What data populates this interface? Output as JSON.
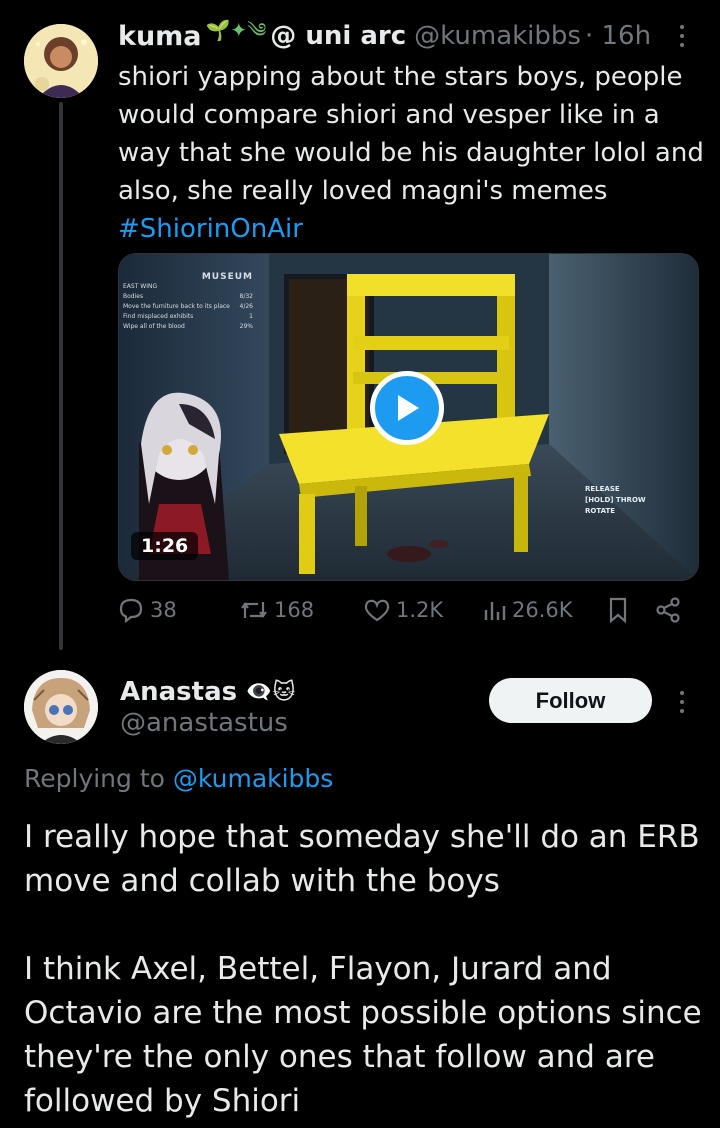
{
  "tweet": {
    "display_name": "kuma",
    "name_emojis": "🌱✦༄",
    "name_suffix": "@ uni arc",
    "handle": "@kumakibbs",
    "time": "· 16h",
    "text": "shiori yapping about the stars boys, people would compare shiori and vesper like in a way that she would be his daughter lolol and also, she really loved magni's memes",
    "hashtag": "#ShiorinOnAir",
    "video": {
      "duration": "1:26",
      "hud_title": "MUSEUM",
      "hud_section": "EAST WING",
      "hud_tasks": [
        "Bodies",
        "Move the furniture back to its place",
        "Find misplaced exhibits",
        "Wipe all of the blood"
      ],
      "hud_counts": [
        "8/32",
        "4/26",
        "1",
        "29%"
      ],
      "controls": [
        "RELEASE",
        "[HOLD] THROW",
        "ROTATE"
      ]
    },
    "stats": {
      "replies": "38",
      "reposts": "168",
      "likes": "1.2K",
      "views": "26.6K"
    }
  },
  "reply": {
    "display_name": "Anastas",
    "name_emojis": "👁‍🗨🐱",
    "handle": "@anastastus",
    "follow_label": "Follow",
    "replying_prefix": "Replying to",
    "replying_handle": "@kumakibbs",
    "paragraph1": "I really hope that someday she'll do an ERB move and collab with the boys",
    "paragraph2": "I think Axel, Bettel, Flayon, Jurard and Octavio are the most possible options since they're the only ones that follow and are followed by Shiori"
  },
  "colors": {
    "background": "#000000",
    "text": "#e7e9ea",
    "muted": "#71767b",
    "accent": "#1d9bf0",
    "follow_bg": "#eff3f4"
  }
}
